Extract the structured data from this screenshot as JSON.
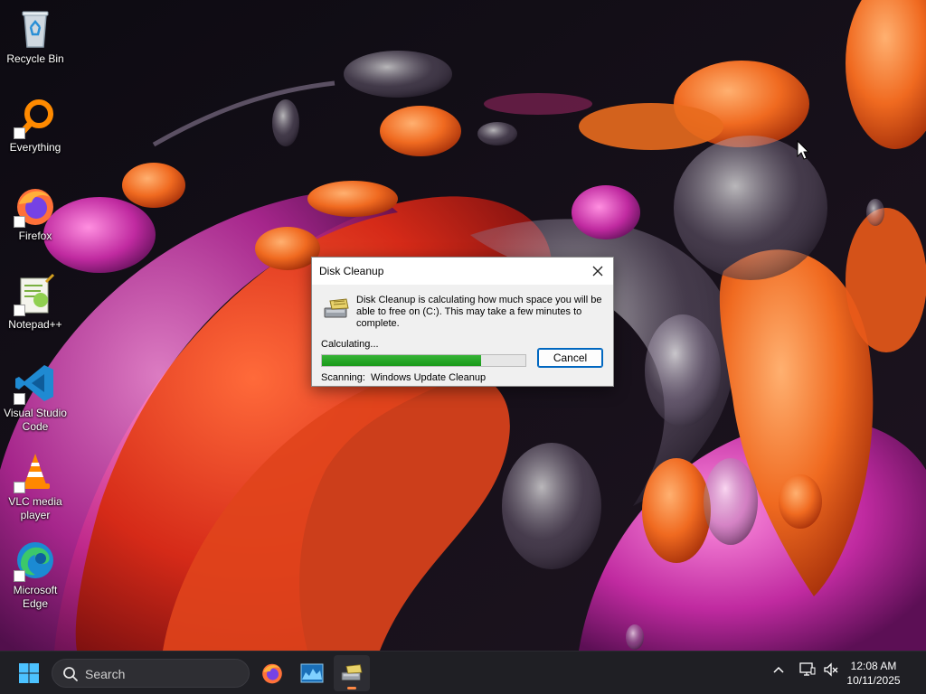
{
  "desktop_icons": [
    {
      "id": "recycle-bin",
      "label": "Recycle Bin",
      "icon": "recycle-bin-icon",
      "shortcut": false
    },
    {
      "id": "everything",
      "label": "Everything",
      "icon": "everything-search-icon",
      "shortcut": true
    },
    {
      "id": "firefox",
      "label": "Firefox",
      "icon": "firefox-icon",
      "shortcut": true
    },
    {
      "id": "notepadpp",
      "label": "Notepad++",
      "icon": "notepad-plus-plus-icon",
      "shortcut": true
    },
    {
      "id": "vscode",
      "label": "Visual Studio Code",
      "icon": "vscode-icon",
      "shortcut": true
    },
    {
      "id": "vlc",
      "label": "VLC media player",
      "icon": "vlc-icon",
      "shortcut": true
    },
    {
      "id": "edge",
      "label": "Microsoft Edge",
      "icon": "edge-icon",
      "shortcut": true
    }
  ],
  "dialog": {
    "title": "Disk Cleanup",
    "message": "Disk Cleanup is calculating how much space you will be able to free on  (C:). This may take a few minutes to complete.",
    "status_label": "Calculating...",
    "progress_fraction": 0.78,
    "cancel_label": "Cancel",
    "scanning_label": "Scanning:",
    "scanning_item": "Windows Update Cleanup"
  },
  "taskbar": {
    "search_placeholder": "Search",
    "apps": [
      {
        "id": "firefox",
        "icon": "firefox-icon",
        "active": false
      },
      {
        "id": "task-manager",
        "icon": "performance-monitor-icon",
        "active": false
      },
      {
        "id": "disk-cleanup",
        "icon": "disk-cleanup-icon",
        "active": true
      }
    ],
    "time": "12:08 AM",
    "date": "10/11/2025"
  },
  "colors": {
    "accent": "#0067c0",
    "progress_fill": "#1fa31f",
    "taskbar_bg": "#1f1f24",
    "active_indicator": "#ff8844"
  }
}
